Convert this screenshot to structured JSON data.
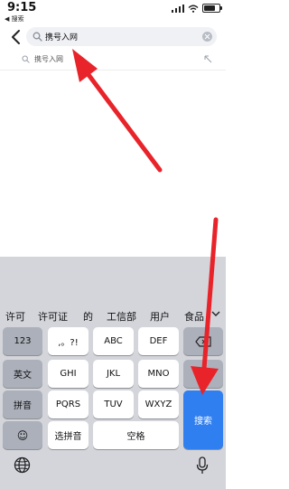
{
  "status_bar": {
    "time": "9:15",
    "back_label": "◀ 搜索"
  },
  "search": {
    "value": "携号入网",
    "placeholder": ""
  },
  "suggestions": [
    {
      "text": "携号入网"
    }
  ],
  "keyboard": {
    "candidates": [
      "许可",
      "许可证",
      "的",
      "工信部",
      "用户",
      "食品"
    ],
    "rows": [
      [
        "123",
        ",。?!",
        "ABC",
        "DEF"
      ],
      [
        "英文",
        "GHI",
        "JKL",
        "MNO"
      ],
      [
        "拼音",
        "PQRS",
        "TUV",
        "WXYZ"
      ],
      [
        "☺",
        "选拼音",
        "空格"
      ]
    ],
    "search_key": "搜索"
  },
  "colors": {
    "arrow": "#e8232a",
    "accent": "#2f7ff0",
    "keyboard_bg": "#d3d5db"
  },
  "icons": [
    "back-chevron-icon",
    "search-icon",
    "clear-icon",
    "wifi-icon",
    "signal-icon",
    "battery-icon",
    "globe-icon",
    "microphone-icon",
    "backspace-icon",
    "chevron-down-icon"
  ]
}
